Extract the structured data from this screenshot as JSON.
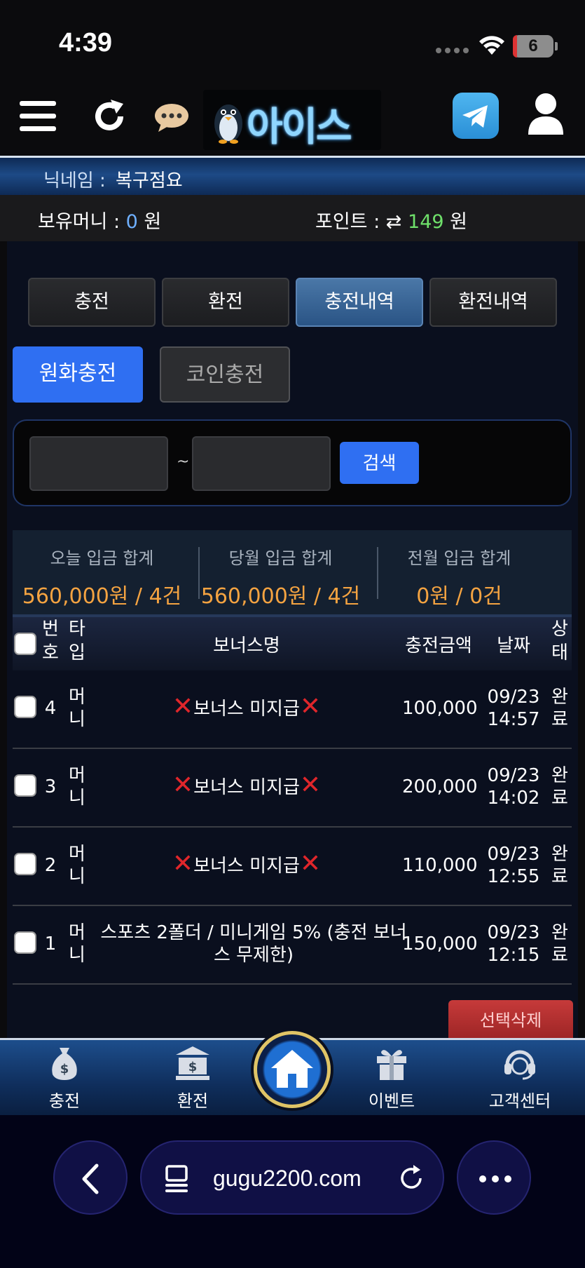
{
  "status": {
    "time": "4:39",
    "battery": "6"
  },
  "header": {
    "logo_text": "아이스"
  },
  "user": {
    "nick_label": "닉네임 :",
    "nick_value": "복구점요",
    "money_label": "보유머니 :",
    "money_value": "0",
    "money_unit": "원",
    "point_label": "포인트 :",
    "point_value": "149",
    "point_unit": "원"
  },
  "tabs": [
    {
      "label": "충전"
    },
    {
      "label": "환전"
    },
    {
      "label": "충전내역",
      "active": true
    },
    {
      "label": "환전내역"
    }
  ],
  "subtabs": {
    "won": "원화충전",
    "coin": "코인충전"
  },
  "search": {
    "tilde": "~",
    "button": "검색"
  },
  "summary": [
    {
      "label": "오늘 입금 합계",
      "value": "560,000원 / 4건"
    },
    {
      "label": "당월 입금 합계",
      "value": "560,000원 / 4건"
    },
    {
      "label": "전월 입금 합계",
      "value": "0원 / 0건"
    }
  ],
  "table": {
    "headers": {
      "num1": "번",
      "num2": "호",
      "type1": "타",
      "type2": "입",
      "bonus": "보너스명",
      "amount": "충전금액",
      "date": "날짜",
      "state1": "상",
      "state2": "태"
    },
    "rows": [
      {
        "num": "4",
        "type1": "머",
        "type2": "니",
        "bonus": "보너스 미지급",
        "bonus_x": true,
        "amount": "100,000",
        "date1": "09/23",
        "date2": "14:57",
        "state1": "완",
        "state2": "료"
      },
      {
        "num": "3",
        "type1": "머",
        "type2": "니",
        "bonus": "보너스 미지급",
        "bonus_x": true,
        "amount": "200,000",
        "date1": "09/23",
        "date2": "14:02",
        "state1": "완",
        "state2": "료"
      },
      {
        "num": "2",
        "type1": "머",
        "type2": "니",
        "bonus": "보너스 미지급",
        "bonus_x": true,
        "amount": "110,000",
        "date1": "09/23",
        "date2": "12:55",
        "state1": "완",
        "state2": "료"
      },
      {
        "num": "1",
        "type1": "머",
        "type2": "니",
        "bonus": "스포츠 2폴더 / 미니게임 5% (충전 보너스 무제한)",
        "bonus_x": false,
        "amount": "150,000",
        "date1": "09/23",
        "date2": "12:15",
        "state1": "완",
        "state2": "료"
      }
    ]
  },
  "delete_button": "선택삭제",
  "bottom_nav": [
    {
      "label": "충전",
      "icon": "money-bag-icon"
    },
    {
      "label": "환전",
      "icon": "bank-icon"
    },
    {
      "label": "이벤트",
      "icon": "gift-icon"
    },
    {
      "label": "고객센터",
      "icon": "headset-icon"
    }
  ],
  "browser": {
    "url": "gugu2200.com"
  }
}
